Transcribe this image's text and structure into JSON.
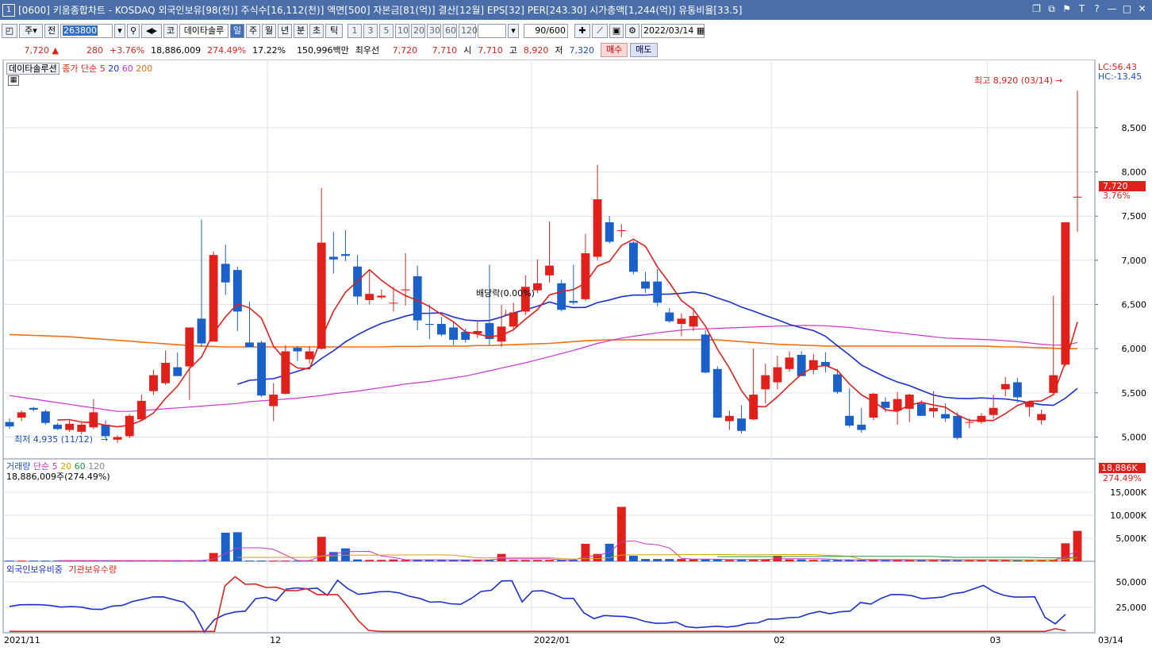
{
  "window": {
    "number": "1",
    "title": "[0600] 키움종합차트 - KOSDAQ 외국인보유[98(천)] 주식수[16,112(천)] 액면[500] 자본금[81(억)] 결산[12월] EPS[32] PER[243.30] 시가총액[1,244(억)] 유통비율[33.5]",
    "controls": [
      "❐",
      "⧉",
      "⚑",
      "T",
      "?",
      "—",
      "□",
      "✕"
    ]
  },
  "toolbar": {
    "market": "주",
    "prev": "전",
    "code": "263800",
    "stock_name": "데이타솔루",
    "periods": [
      "일",
      "주",
      "월",
      "년",
      "분",
      "초",
      "틱"
    ],
    "active_period": "일",
    "intervals": [
      "1",
      "3",
      "5",
      "10",
      "20",
      "30",
      "60",
      "120"
    ],
    "count": "90",
    "count_total": "/600",
    "date": "2022/03/14",
    "kor": "코"
  },
  "quote": {
    "price": "7,720",
    "change": "280",
    "change_pct": "+3.76%",
    "volume": "18,886,009",
    "vol_pct": "274.49%",
    "turnover": "17.22%",
    "amount": "150,996백만",
    "pref_label": "최우선",
    "ask": "7,720",
    "bid": "7,710",
    "open_label": "시",
    "open": "7,710",
    "high_label": "고",
    "high": "8,920",
    "low_label": "저",
    "low": "7,320",
    "buy": "매수",
    "sell": "매도"
  },
  "main_legend": {
    "name": "데이타솔루션",
    "ma_label": "종가 단순",
    "ma5": "5",
    "ma20": "20",
    "ma60": "60",
    "ma200": "200"
  },
  "annotations": {
    "high": "최고 8,920 (03/14)",
    "low": "최저 4,935 (11/12)",
    "dividend": "배당락(0.00%)",
    "lc": "LC:56.43",
    "hc": "HC:-13.45",
    "price_tag": "7,720",
    "price_pct": "3.76%",
    "vol_tag": "18,886K",
    "vol_pct": "274.49%"
  },
  "volume_legend": {
    "label": "거래량",
    "ma_label": "단순",
    "ma5": "5",
    "ma20": "20",
    "ma60": "60",
    "ma120": "120",
    "value": "18,886,009주(274.49%)"
  },
  "holding_legend": {
    "foreign": "외국인보유비중",
    "inst": "기관보유수량"
  },
  "colors": {
    "up": "#e0201b",
    "down": "#1b5fc9",
    "ma5": "#e0201b",
    "ma20": "#1b2fd0",
    "ma60": "#cc33cc",
    "ma200": "#f07010",
    "vol_ma20": "#d8a000",
    "vol_ma60": "#1a9a40",
    "vol_ma120": "#888888"
  },
  "chart_data": {
    "type": "candlestick",
    "price_ticks": [
      "8,500",
      "8,000",
      "7,500",
      "7,000",
      "6,500",
      "6,000",
      "5,500",
      "5,000"
    ],
    "price_tick_values": [
      8500,
      8000,
      7500,
      7000,
      6500,
      6000,
      5500,
      5000
    ],
    "ylim": [
      4780,
      9200
    ],
    "volume_ticks": [
      "15,000K",
      "10,000K",
      "5,000K"
    ],
    "volume_tick_values": [
      15000,
      10000,
      5000
    ],
    "volume_ylim": [
      0,
      21000
    ],
    "holding_ticks": [
      "50,000",
      "25,000"
    ],
    "holding_tick_values": [
      50000,
      25000
    ],
    "holding_ylim": [
      0,
      67000
    ],
    "x_labels": [
      {
        "label": "2021/11",
        "index": 0
      },
      {
        "label": "12",
        "index": 22
      },
      {
        "label": "2022/01",
        "index": 44
      },
      {
        "label": "02",
        "index": 64
      },
      {
        "label": "03",
        "index": 82
      },
      {
        "label": "03/14",
        "index": 89
      }
    ],
    "ohlc": [
      [
        5170,
        5210,
        5090,
        5120
      ],
      [
        5220,
        5300,
        5180,
        5280
      ],
      [
        5330,
        5340,
        5290,
        5310
      ],
      [
        5290,
        5310,
        5140,
        5160
      ],
      [
        5140,
        5160,
        5080,
        5090
      ],
      [
        5080,
        5190,
        5060,
        5150
      ],
      [
        5060,
        5160,
        5030,
        5140
      ],
      [
        5110,
        5430,
        5090,
        5280
      ],
      [
        5140,
        5190,
        4990,
        5010
      ],
      [
        4970,
        5020,
        4935,
        5000
      ],
      [
        5010,
        5260,
        4990,
        5240
      ],
      [
        5200,
        5480,
        5180,
        5410
      ],
      [
        5520,
        5760,
        5480,
        5700
      ],
      [
        5610,
        5980,
        5590,
        5840
      ],
      [
        5790,
        5960,
        5760,
        5690
      ],
      [
        5800,
        6230,
        5420,
        6240
      ],
      [
        6340,
        7460,
        6020,
        6060
      ],
      [
        6080,
        7100,
        6090,
        7060
      ],
      [
        6960,
        7180,
        6610,
        6750
      ],
      [
        6890,
        6930,
        6200,
        6420
      ],
      [
        6070,
        6530,
        6040,
        6020
      ],
      [
        6070,
        6090,
        5450,
        5470
      ],
      [
        5350,
        5610,
        5180,
        5480
      ],
      [
        5490,
        6040,
        5480,
        5970
      ],
      [
        6010,
        6030,
        5860,
        5970
      ],
      [
        5880,
        6030,
        5830,
        5970
      ],
      [
        6000,
        7820,
        5990,
        7200
      ],
      [
        7040,
        7320,
        6850,
        7010
      ],
      [
        7070,
        7340,
        6990,
        7050
      ],
      [
        6930,
        7060,
        6500,
        6590
      ],
      [
        6550,
        6880,
        6500,
        6620
      ],
      [
        6580,
        6670,
        6560,
        6600
      ],
      [
        6520,
        6700,
        6420,
        6520
      ],
      [
        6660,
        7080,
        6490,
        6670
      ],
      [
        6820,
        6940,
        6210,
        6320
      ],
      [
        6280,
        6500,
        6110,
        6270
      ],
      [
        6280,
        6360,
        6140,
        6160
      ],
      [
        6240,
        6310,
        6040,
        6100
      ],
      [
        6190,
        6230,
        6070,
        6100
      ],
      [
        6170,
        6320,
        6120,
        6200
      ],
      [
        6290,
        6950,
        6040,
        6110
      ],
      [
        6080,
        6500,
        6020,
        6250
      ],
      [
        6250,
        6520,
        6210,
        6410
      ],
      [
        6420,
        6830,
        6380,
        6700
      ],
      [
        6660,
        7010,
        6630,
        6740
      ],
      [
        6830,
        7440,
        6750,
        6940
      ],
      [
        6740,
        6780,
        6420,
        6440
      ],
      [
        6540,
        6950,
        6500,
        6520
      ],
      [
        6560,
        7300,
        6540,
        7080
      ],
      [
        7040,
        8080,
        7000,
        7690
      ],
      [
        7430,
        7500,
        7190,
        7210
      ],
      [
        7330,
        7410,
        7260,
        7340
      ],
      [
        7200,
        7220,
        6840,
        6870
      ],
      [
        6760,
        6870,
        6630,
        6680
      ],
      [
        6760,
        6900,
        6480,
        6520
      ],
      [
        6410,
        6460,
        6290,
        6310
      ],
      [
        6280,
        6400,
        6140,
        6340
      ],
      [
        6250,
        6460,
        6200,
        6370
      ],
      [
        6160,
        6210,
        5720,
        5730
      ],
      [
        5770,
        5800,
        5220,
        5220
      ],
      [
        5180,
        5300,
        5080,
        5240
      ],
      [
        5210,
        5360,
        5040,
        5070
      ],
      [
        5200,
        6000,
        5190,
        5480
      ],
      [
        5540,
        5830,
        5380,
        5700
      ],
      [
        5620,
        5920,
        5540,
        5790
      ],
      [
        5770,
        5970,
        5740,
        5900
      ],
      [
        5930,
        5970,
        5690,
        5690
      ],
      [
        5760,
        5940,
        5710,
        5870
      ],
      [
        5850,
        5960,
        5730,
        5800
      ],
      [
        5710,
        5770,
        5490,
        5510
      ],
      [
        5240,
        5550,
        5110,
        5130
      ],
      [
        5140,
        5330,
        5050,
        5080
      ],
      [
        5220,
        5500,
        5190,
        5490
      ],
      [
        5400,
        5450,
        5280,
        5330
      ],
      [
        5300,
        5510,
        5140,
        5430
      ],
      [
        5320,
        5490,
        5170,
        5480
      ],
      [
        5380,
        5420,
        5240,
        5240
      ],
      [
        5290,
        5520,
        5220,
        5330
      ],
      [
        5260,
        5380,
        5170,
        5210
      ],
      [
        5240,
        5280,
        4970,
        4990
      ],
      [
        5170,
        5210,
        5100,
        5170
      ],
      [
        5170,
        5270,
        5150,
        5240
      ],
      [
        5250,
        5480,
        5210,
        5330
      ],
      [
        5540,
        5680,
        5460,
        5600
      ],
      [
        5620,
        5670,
        5390,
        5450
      ],
      [
        5340,
        5390,
        5230,
        5400
      ],
      [
        5190,
        5310,
        5140,
        5260
      ],
      [
        5500,
        6600,
        5470,
        5700
      ],
      [
        5820,
        7430,
        5800,
        7430
      ],
      [
        7710,
        8920,
        7320,
        7720
      ]
    ],
    "volume": [
      150,
      150,
      150,
      150,
      150,
      150,
      150,
      150,
      150,
      150,
      150,
      150,
      150,
      150,
      150,
      150,
      200,
      1800,
      6200,
      6300,
      150,
      150,
      150,
      150,
      150,
      150,
      5300,
      2000,
      2800,
      400,
      300,
      300,
      400,
      300,
      300,
      300,
      300,
      300,
      300,
      300,
      300,
      1600,
      300,
      300,
      300,
      300,
      300,
      300,
      3800,
      1600,
      3800,
      11800,
      1200,
      500,
      500,
      500,
      500,
      400,
      400,
      400,
      300,
      400,
      400,
      400,
      1200,
      400,
      400,
      300,
      300,
      300,
      300,
      300,
      300,
      300,
      300,
      300,
      300,
      300,
      300,
      300,
      300,
      300,
      300,
      300,
      300,
      300,
      300,
      300,
      3900,
      6600,
      18886
    ],
    "series": [
      {
        "name": "외국인보유비중",
        "values": [
          25800,
          27400,
          27600,
          27500,
          26700,
          25200,
          25600,
          25200,
          23100,
          22900,
          26100,
          26800,
          30700,
          32900,
          35100,
          35200,
          32500,
          30000,
          20000,
          700,
          13000,
          17900,
          20400,
          21200,
          33400,
          34700,
          31300,
          42800,
          44000,
          43000,
          43800,
          36800,
          51500,
          43300,
          37700,
          38700,
          40200,
          40500,
          39100,
          35800,
          33700,
          30000,
          30400,
          28400,
          27900,
          33400,
          40500,
          41700,
          50800,
          51000,
          30200,
          40800,
          41200,
          38000,
          33700,
          33700,
          19600,
          13900,
          16900,
          16300,
          15900,
          14200,
          11000,
          9300,
          9400,
          10600,
          5900,
          4900,
          5700,
          6400,
          5600,
          6700,
          9200,
          9700,
          13400,
          13500,
          14800,
          15200,
          18700,
          20900,
          18700,
          20500,
          21300,
          29700,
          28100,
          33700,
          37500,
          37500,
          36400,
          33400,
          34100,
          35000,
          38300,
          39600,
          42900,
          46400,
          40300,
          36700,
          35000,
          35000,
          35300,
          15000,
          8800,
          18100
        ]
      },
      {
        "name": "기관보유수량",
        "values": [
          1300,
          1300,
          1300,
          1300,
          1300,
          1300,
          1300,
          1300,
          1300,
          1300,
          1300,
          1300,
          1300,
          1300,
          1300,
          1300,
          1300,
          1300,
          1300,
          1300,
          1300,
          45800,
          55000,
          47500,
          47800,
          44400,
          44700,
          41500,
          41300,
          43200,
          37500,
          37500,
          37500,
          25500,
          12100,
          2400,
          1300,
          1300,
          1300,
          1300,
          1300,
          1300,
          1300,
          1300,
          1300,
          1300,
          1300,
          1300,
          1300,
          1300,
          1300,
          1300,
          1300,
          1300,
          1300,
          1300,
          1300,
          1300,
          1300,
          1300,
          1300,
          1300,
          1300,
          1300,
          1300,
          1300,
          1300,
          1300,
          1300,
          1300,
          1300,
          1300,
          1300,
          1300,
          1300,
          1300,
          1300,
          1300,
          1300,
          1300,
          1300,
          1300,
          1300,
          1300,
          1300,
          1300,
          1300,
          1300,
          1300,
          1300,
          1300,
          1300,
          1300,
          1300,
          1300,
          1300,
          1300,
          1300,
          1300,
          1300,
          1300,
          1300,
          4000,
          2000
        ]
      }
    ],
    "ma200": [
      6160,
      6155,
      6150,
      6145,
      6140,
      6135,
      6125,
      6115,
      6105,
      6095,
      6085,
      6075,
      6065,
      6055,
      6045,
      6035,
      6030,
      6025,
      6020,
      6020,
      6020,
      6020,
      6020,
      6020,
      6020,
      6020,
      6020,
      6020,
      6020,
      6020,
      6020,
      6020,
      6025,
      6025,
      6025,
      6030,
      6030,
      6030,
      6030,
      6035,
      6035,
      6040,
      6045,
      6050,
      6055,
      6060,
      6070,
      6080,
      6090,
      6095,
      6100,
      6100,
      6100,
      6100,
      6100,
      6100,
      6100,
      6100,
      6100,
      6100,
      6090,
      6080,
      6070,
      6060,
      6050,
      6045,
      6040,
      6035,
      6030,
      6030,
      6030,
      6030,
      6030,
      6030,
      6030,
      6030,
      6030,
      6030,
      6030,
      6030,
      6030,
      6030,
      6025,
      6020,
      6020,
      6015,
      6010,
      6005,
      6000,
      6000
    ],
    "ma60": [
      5470,
      5450,
      5430,
      5410,
      5390,
      5370,
      5350,
      5330,
      5310,
      5290,
      5290,
      5300,
      5310,
      5320,
      5330,
      5340,
      5350,
      5360,
      5370,
      5380,
      5400,
      5410,
      5420,
      5430,
      5440,
      5455,
      5470,
      5490,
      5505,
      5520,
      5540,
      5560,
      5580,
      5600,
      5615,
      5630,
      5650,
      5670,
      5690,
      5720,
      5750,
      5780,
      5810,
      5840,
      5875,
      5910,
      5945,
      5980,
      6020,
      6060,
      6090,
      6120,
      6140,
      6160,
      6180,
      6195,
      6210,
      6220,
      6225,
      6230,
      6235,
      6240,
      6245,
      6250,
      6255,
      6260,
      6262,
      6262,
      6260,
      6250,
      6240,
      6225,
      6210,
      6195,
      6180,
      6165,
      6150,
      6135,
      6120,
      6115,
      6110,
      6105,
      6100,
      6090,
      6080,
      6065,
      6050,
      6040,
      6040,
      6070
    ]
  }
}
